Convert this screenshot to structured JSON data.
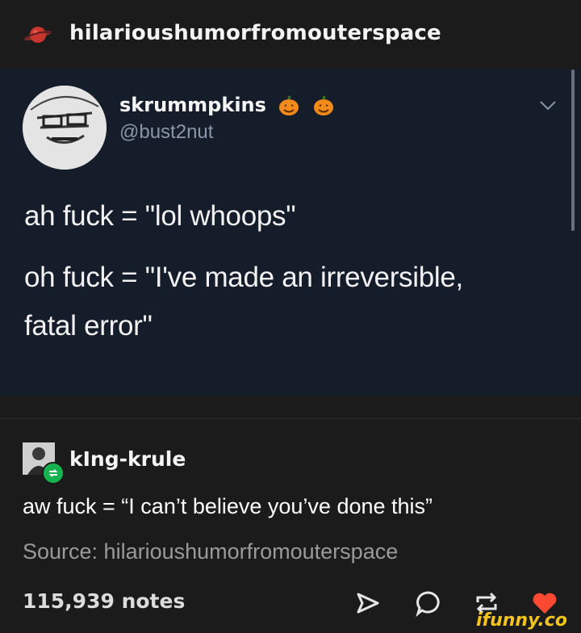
{
  "header": {
    "blog_name": "hilarioushumorfromouterspace",
    "avatar_icon": "planet-icon"
  },
  "tweet": {
    "display_name": "skrummpkins",
    "handle": "@bust2nut",
    "emoji_icons": [
      "pumpkin-icon",
      "pumpkin-icon"
    ],
    "lines": [
      "ah fuck = \"lol whoops\"",
      "oh fuck = \"I've made an irreversible,",
      "fatal error\""
    ],
    "background_color": "#151c2a"
  },
  "reblog": {
    "username": "kIng-krule",
    "text": "aw fuck = “I can’t believe you’ve done this”",
    "badge_color": "#14b34f"
  },
  "source": "Source: hilarioushumorfromouterspace",
  "footer": {
    "notes": "115,939 notes",
    "actions": [
      "share-icon",
      "comment-icon",
      "reblog-icon",
      "like-icon"
    ],
    "like_color": "#ff4930"
  },
  "watermark": "ifunny.co"
}
